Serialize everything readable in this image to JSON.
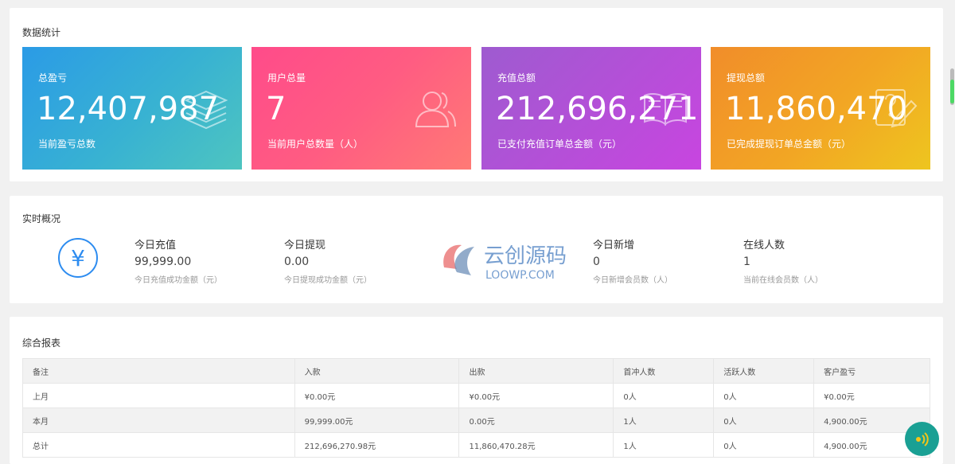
{
  "stats": {
    "title": "数据统计",
    "cards": [
      {
        "label": "总盈亏",
        "value": "12,407,987",
        "desc": "当前盈亏总数",
        "icon": "layers-icon"
      },
      {
        "label": "用户总量",
        "value": "7",
        "desc": "当前用户总数量（人）",
        "icon": "users-icon"
      },
      {
        "label": "充值总额",
        "value": "212,696,271",
        "desc": "已支付充值订单总金额（元）",
        "icon": "book-icon"
      },
      {
        "label": "提现总额",
        "value": "11,860,470",
        "desc": "已完成提现订单总金额（元）",
        "icon": "edit-icon"
      }
    ]
  },
  "realtime": {
    "title": "实时概况",
    "icon": "yen-icon",
    "icon_glyph": "¥",
    "items": [
      {
        "title": "今日充值",
        "value": "99,999.00",
        "desc": "今日充值成功金额（元）"
      },
      {
        "title": "今日提现",
        "value": "0.00",
        "desc": "今日提现成功金额（元）"
      },
      {
        "title": "今日新增",
        "value": "0",
        "desc": "今日新增会员数（人）"
      },
      {
        "title": "在线人数",
        "value": "1",
        "desc": "当前在线会员数（人）"
      }
    ]
  },
  "watermark": {
    "cn": "云创源码",
    "en": "LOOWP.COM"
  },
  "report": {
    "title": "综合报表",
    "headers": [
      "备注",
      "入款",
      "出款",
      "首冲人数",
      "活跃人数",
      "客户盈亏"
    ],
    "rows": [
      [
        "上月",
        "¥0.00元",
        "¥0.00元",
        "0人",
        "0人",
        "¥0.00元"
      ],
      [
        "本月",
        "99,999.00元",
        "0.00元",
        "1人",
        "0人",
        "4,900.00元"
      ],
      [
        "总计",
        "212,696,270.98元",
        "11,860,470.28元",
        "1人",
        "0人",
        "4,900.00元"
      ]
    ]
  },
  "float_button": {
    "icon": "sound-icon"
  }
}
